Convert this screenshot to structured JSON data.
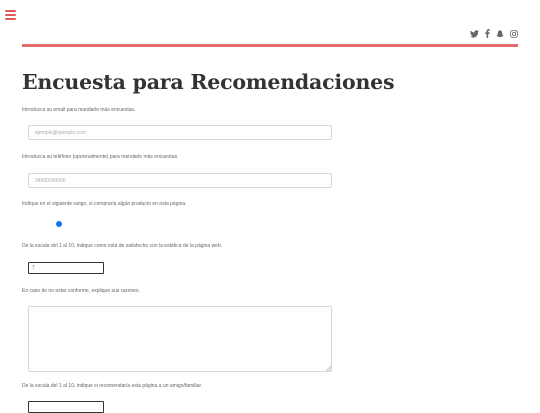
{
  "header": {
    "social": [
      {
        "name": "twitter-icon",
        "glyph": "🐦"
      },
      {
        "name": "facebook-icon",
        "glyph": "f"
      },
      {
        "name": "snapchat-icon",
        "glyph": "👻"
      },
      {
        "name": "instagram-icon",
        "glyph": "◎"
      }
    ],
    "accent_color": "#e46a6a"
  },
  "page": {
    "title": "Encuesta para Recomendaciones"
  },
  "form": {
    "email_label": "Introduzca su email para mandarle más encuestas.",
    "email_placeholder": "ejemplo@ejemplo.com",
    "phone_label": "Introduzca su teléfono (opcionalmente) para mandarle más encuestas.",
    "phone_placeholder": "34000000000",
    "range_label": "Indique en el siguiente rango, si compraría algún producto en esta página.",
    "range_color": "#1a73e8",
    "aesthetic_label": "De la escala del 1 al 10, indique como está de satisfecho con la estética de la página web.",
    "aesthetic_value": "7",
    "reasons_label": "En caso de no estar conforme, explique sus razones.",
    "recommend_label": "De la escala del 1 al 10, indique si recomendaría esta página a un amigo/familiar."
  }
}
